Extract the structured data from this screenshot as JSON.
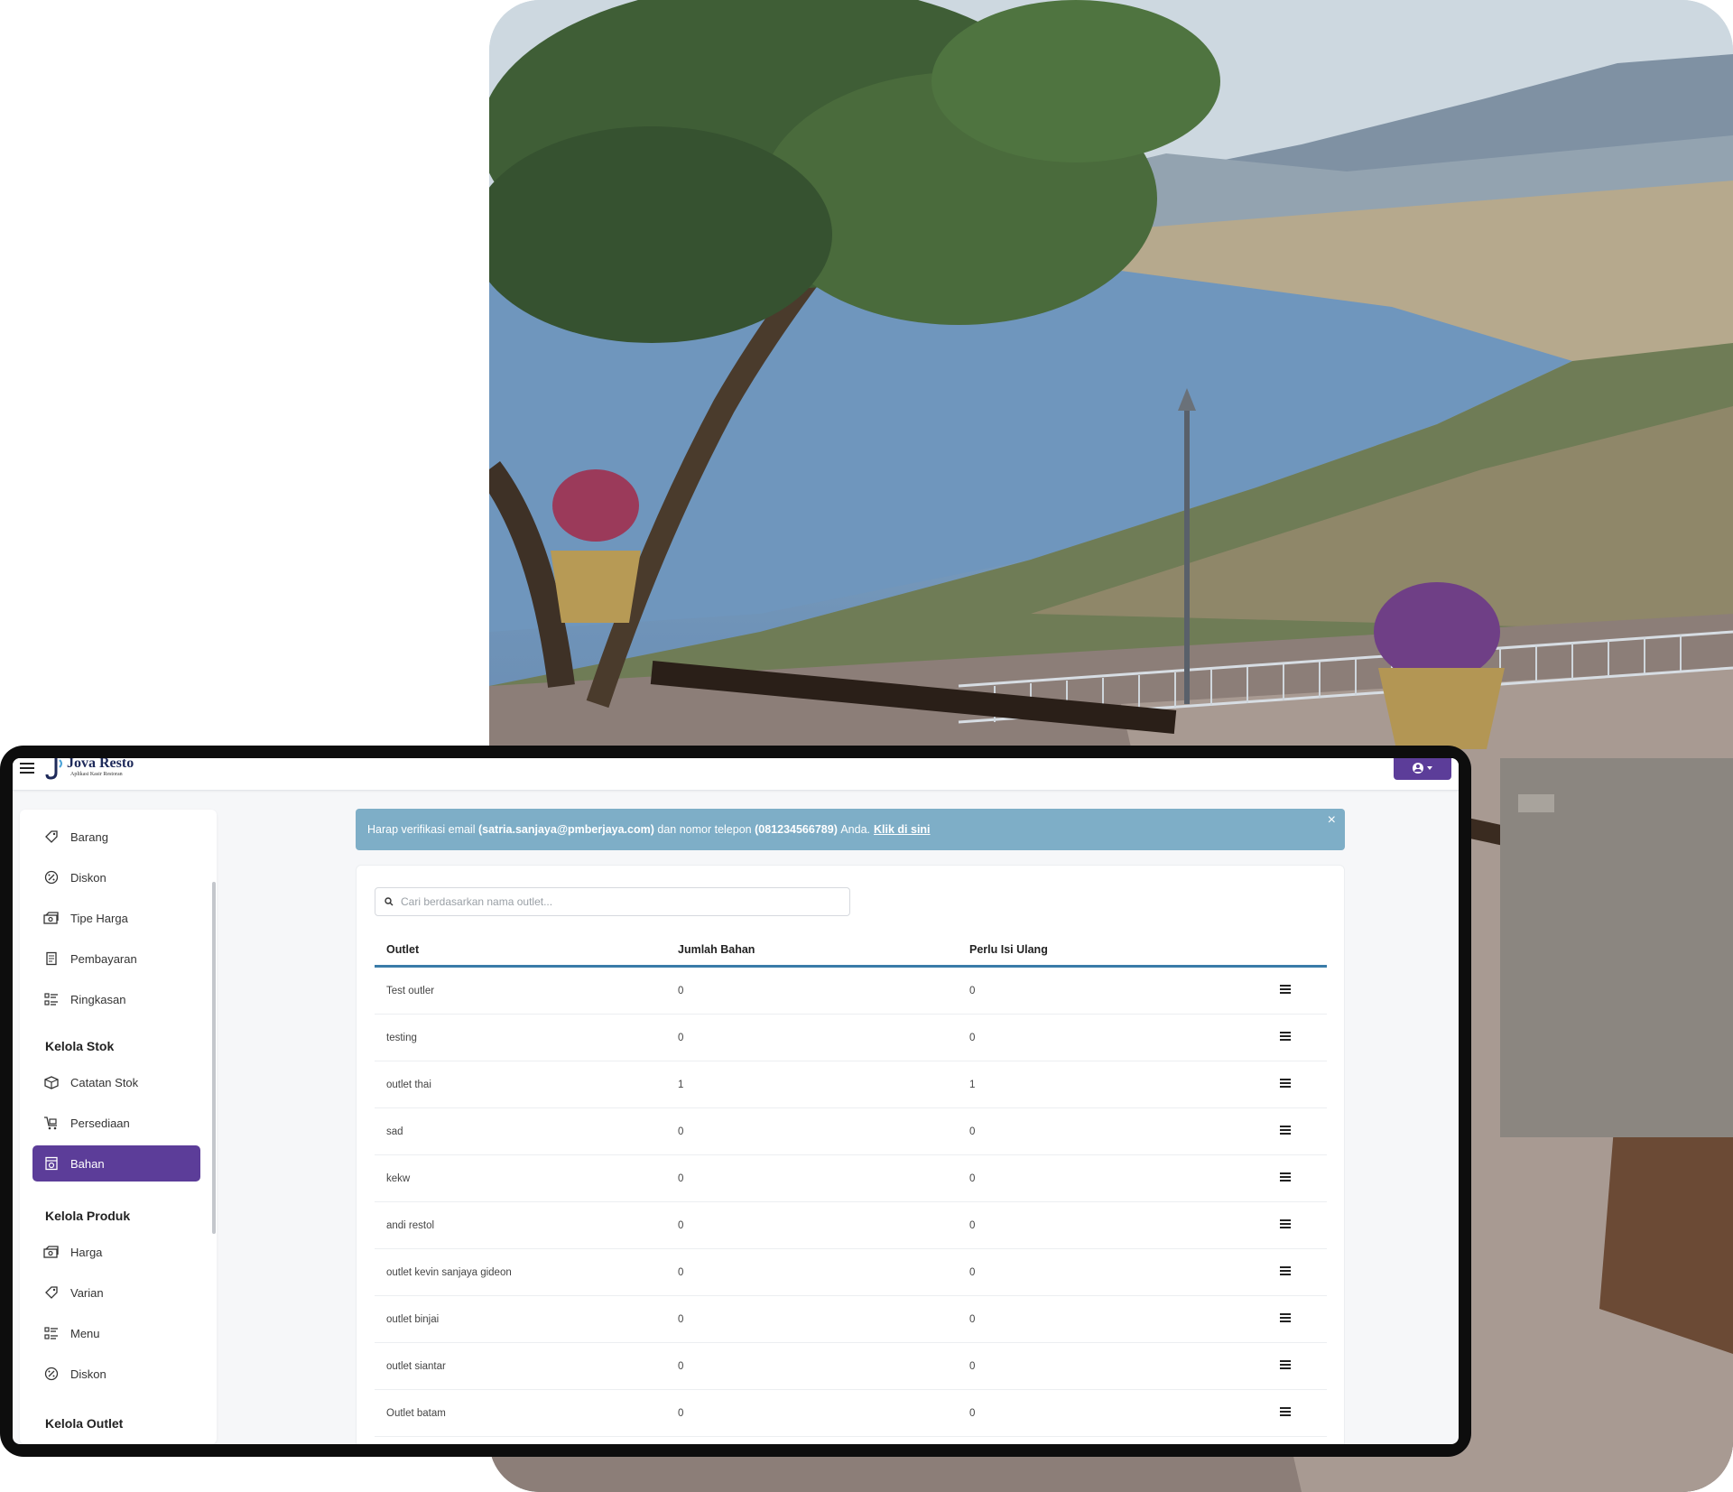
{
  "app": {
    "title": "Jova Resto",
    "subtitle": "Aplikasi Kasir Restoran"
  },
  "colors": {
    "primary": "#5c3d99",
    "alert": "#7eaec7",
    "table_header_line": "#3a7ca8"
  },
  "sidebar": {
    "items_top": [
      {
        "label": "Barang",
        "icon": "tag-icon"
      },
      {
        "label": "Diskon",
        "icon": "percent-badge-icon"
      },
      {
        "label": "Tipe Harga",
        "icon": "money-icon"
      },
      {
        "label": "Pembayaran",
        "icon": "receipt-icon"
      },
      {
        "label": "Ringkasan",
        "icon": "list-icon"
      }
    ],
    "section_stok": "Kelola Stok",
    "items_stok": [
      {
        "label": "Catatan Stok",
        "icon": "box-icon"
      },
      {
        "label": "Persediaan",
        "icon": "cart-icon"
      },
      {
        "label": "Bahan",
        "icon": "ingredient-icon",
        "active": true
      }
    ],
    "section_produk": "Kelola Produk",
    "items_produk": [
      {
        "label": "Harga",
        "icon": "money-icon"
      },
      {
        "label": "Varian",
        "icon": "tag-icon"
      },
      {
        "label": "Menu",
        "icon": "list-icon"
      },
      {
        "label": "Diskon",
        "icon": "percent-badge-icon"
      }
    ],
    "section_outlet": "Kelola Outlet"
  },
  "alert": {
    "text_before": "Harap verifikasi email",
    "email": "(satria.sanjaya@pmberjaya.com)",
    "text_mid": "dan nomor telepon",
    "phone": "(081234566789)",
    "text_after": "Anda.",
    "link": "Klik di sini",
    "close": "×"
  },
  "search": {
    "placeholder": "Cari berdasarkan nama outlet..."
  },
  "table": {
    "columns": [
      "Outlet",
      "Jumlah Bahan",
      "Perlu Isi Ulang"
    ],
    "rows": [
      {
        "outlet": "Test outler",
        "jumlah": "0",
        "perlu": "0"
      },
      {
        "outlet": "testing",
        "jumlah": "0",
        "perlu": "0"
      },
      {
        "outlet": "outlet thai",
        "jumlah": "1",
        "perlu": "1"
      },
      {
        "outlet": "sad",
        "jumlah": "0",
        "perlu": "0"
      },
      {
        "outlet": "kekw",
        "jumlah": "0",
        "perlu": "0"
      },
      {
        "outlet": "andi restol",
        "jumlah": "0",
        "perlu": "0"
      },
      {
        "outlet": "outlet kevin sanjaya gideon",
        "jumlah": "0",
        "perlu": "0"
      },
      {
        "outlet": "outlet binjai",
        "jumlah": "0",
        "perlu": "0"
      },
      {
        "outlet": "outlet siantar",
        "jumlah": "0",
        "perlu": "0"
      },
      {
        "outlet": "Outlet batam",
        "jumlah": "0",
        "perlu": "0"
      }
    ]
  }
}
